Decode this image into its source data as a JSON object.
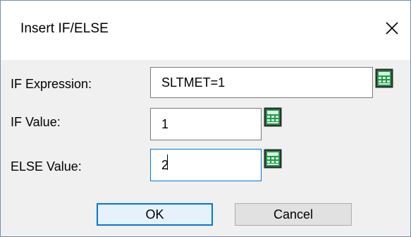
{
  "dialog": {
    "title": "Insert IF/ELSE",
    "close_glyph": "✕"
  },
  "form": {
    "if_expression": {
      "label": "IF Expression:",
      "value": "SLTMET=1"
    },
    "if_value": {
      "label": "IF Value:",
      "value": "1"
    },
    "else_value": {
      "label": "ELSE Value:",
      "value": "2"
    }
  },
  "buttons": {
    "ok_label": "OK",
    "cancel_label": "Cancel"
  },
  "icons": {
    "calculator": "calculator-icon",
    "close": "close-icon"
  },
  "colors": {
    "client_bg": "#f0f0f0",
    "focus_border": "#0078d7",
    "default_button_bg": "#e5f1fb",
    "calculator_green": "#1f9a46"
  }
}
